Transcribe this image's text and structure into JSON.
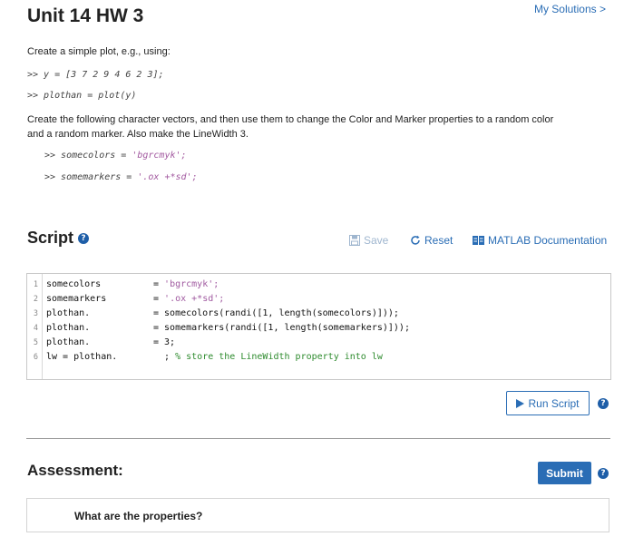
{
  "header": {
    "title": "Unit 14 HW 3",
    "my_solutions": "My Solutions >"
  },
  "instructions": {
    "intro": "Create a simple plot, e.g., using:",
    "code1_prefix": ">> y = ",
    "code1_value": "[3  7  2  9  4  6  2  3];",
    "code2": ">> plothan = plot(y)",
    "para_line1": "Create the following character vectors, and then use them to change the Color and Marker properties to a random color",
    "para_line2": "and a random marker. Also make the LineWidth 3.",
    "code3_prefix": ">> somecolors = ",
    "code3_value": "'bgrcmyk';",
    "code4_prefix": ">> somemarkers = ",
    "code4_value": "'.ox +*sd';"
  },
  "script": {
    "heading": "Script",
    "help_glyph": "?",
    "toolbar": {
      "save": "Save",
      "reset": "Reset",
      "doc": "MATLAB Documentation"
    },
    "lines": [
      {
        "n": "1",
        "left": "somecolors",
        "right_plain": "= ",
        "right_str": "'bgrcmyk';",
        "right_rest": "",
        "comment": ""
      },
      {
        "n": "2",
        "left": "somemarkers",
        "right_plain": "= ",
        "right_str": "'.ox +*sd';",
        "right_rest": "",
        "comment": ""
      },
      {
        "n": "3",
        "left": "plothan.",
        "right_plain": "= somecolors(randi([1, length(somecolors)]));",
        "right_str": "",
        "right_rest": "",
        "comment": ""
      },
      {
        "n": "4",
        "left": "plothan.",
        "right_plain": "= somemarkers(randi([1, length(somemarkers)]));",
        "right_str": "",
        "right_rest": "",
        "comment": ""
      },
      {
        "n": "5",
        "left": "plothan.",
        "right_plain": "= 3;",
        "right_str": "",
        "right_rest": "",
        "comment": ""
      },
      {
        "n": "6",
        "left": "lw = plothan.",
        "right_plain": "  ; ",
        "right_str": "",
        "right_rest": "",
        "comment": "% store the LineWidth property into lw"
      }
    ],
    "run_button": "Run Script"
  },
  "assessment": {
    "heading": "Assessment:",
    "submit": "Submit",
    "question": "What are the properties?"
  },
  "colors": {
    "accent": "#2a6db5",
    "string": "#a05aa0",
    "comment": "#2e8b2e"
  }
}
